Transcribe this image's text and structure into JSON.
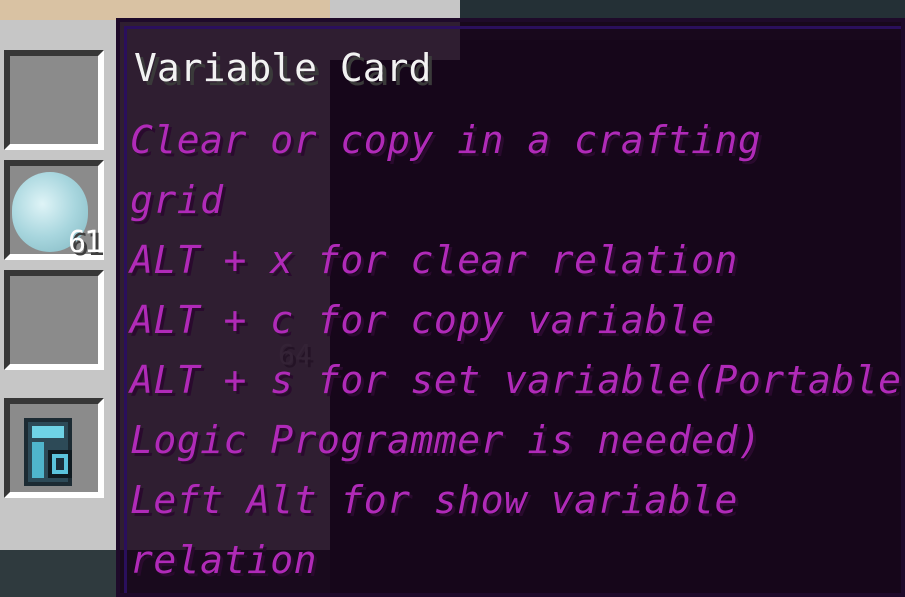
{
  "inventory": {
    "slot_item_count": "61",
    "background_item_count": "64"
  },
  "tooltip": {
    "title": "Variable Card",
    "lines": [
      "Clear or copy in a crafting",
      "grid",
      "ALT + x for clear relation",
      "ALT + c for copy variable",
      "ALT + s for set variable(Portable",
      "Logic Programmer is needed)",
      "Left Alt for show variable",
      "relation"
    ]
  },
  "colors": {
    "tooltip_text": "#b02ab8",
    "tooltip_title": "#f2f2f2",
    "tooltip_bg": "#160218"
  },
  "icons": [
    "prismarine-crystal-icon",
    "variable-card-icon"
  ]
}
